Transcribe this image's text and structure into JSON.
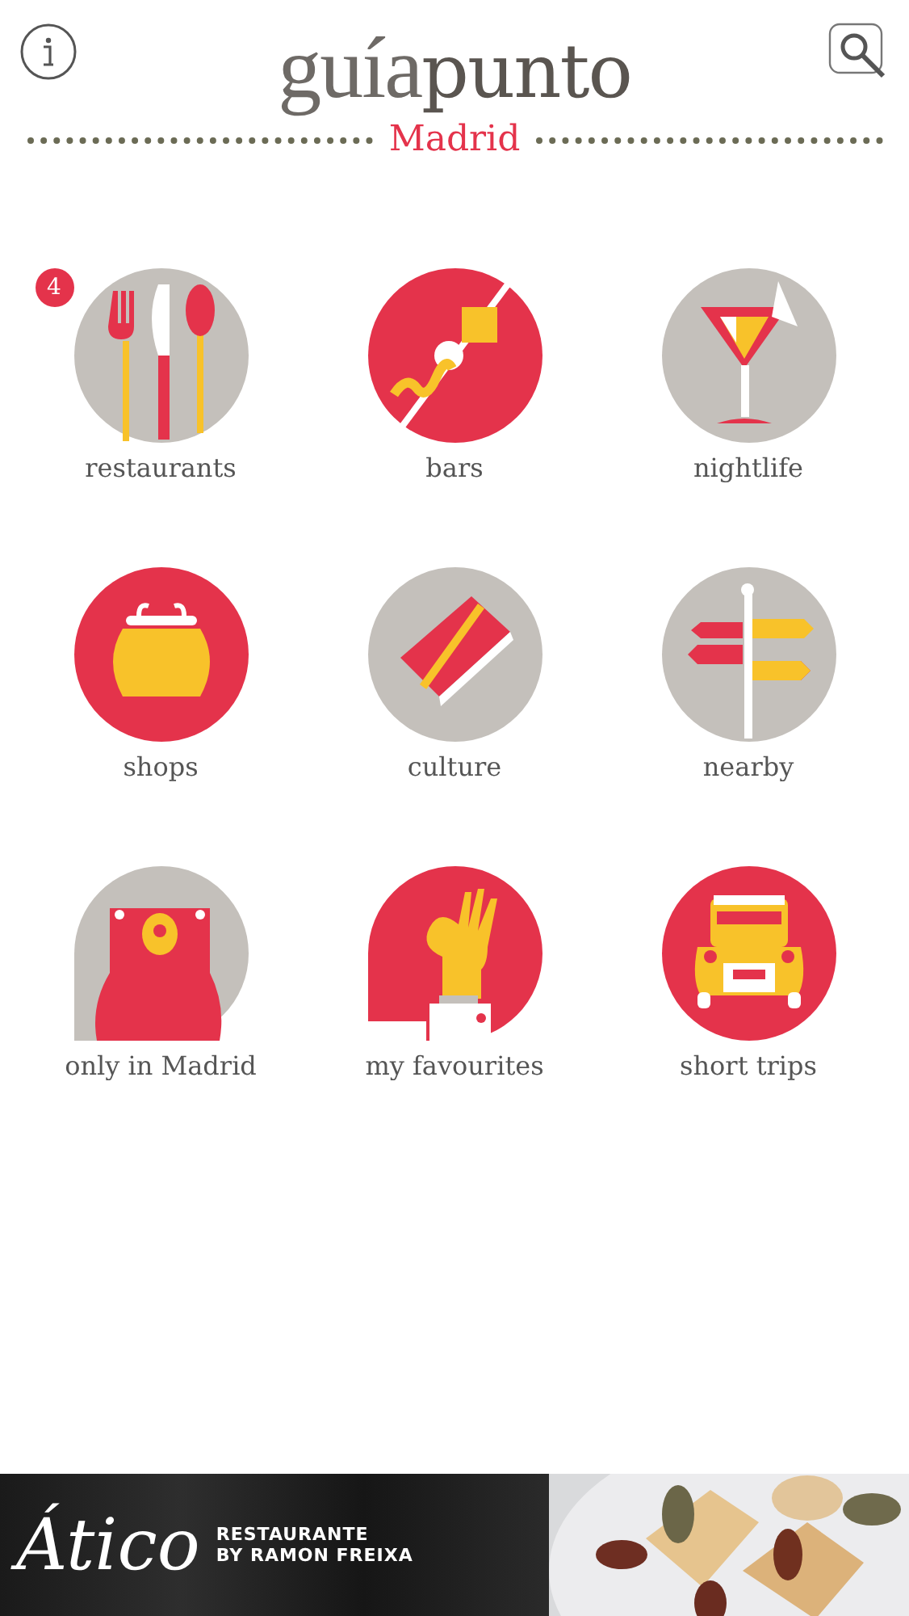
{
  "header": {
    "logo_light": "guía",
    "logo_bold": "punto",
    "city": "Madrid"
  },
  "categories": [
    {
      "kind": "restaurants",
      "label": "restaurants",
      "badge": "4"
    },
    {
      "kind": "bars",
      "label": "bars"
    },
    {
      "kind": "nightlife",
      "label": "nightlife"
    },
    {
      "kind": "shops",
      "label": "shops"
    },
    {
      "kind": "culture",
      "label": "culture"
    },
    {
      "kind": "nearby",
      "label": "nearby"
    },
    {
      "kind": "local",
      "label": "only in Madrid"
    },
    {
      "kind": "favourites",
      "label": "my favourites"
    },
    {
      "kind": "trips",
      "label": "short trips"
    }
  ],
  "ad": {
    "brand": "Ático",
    "tagline": [
      "RESTAURANTE",
      "BY RAMON FREIXA"
    ]
  }
}
